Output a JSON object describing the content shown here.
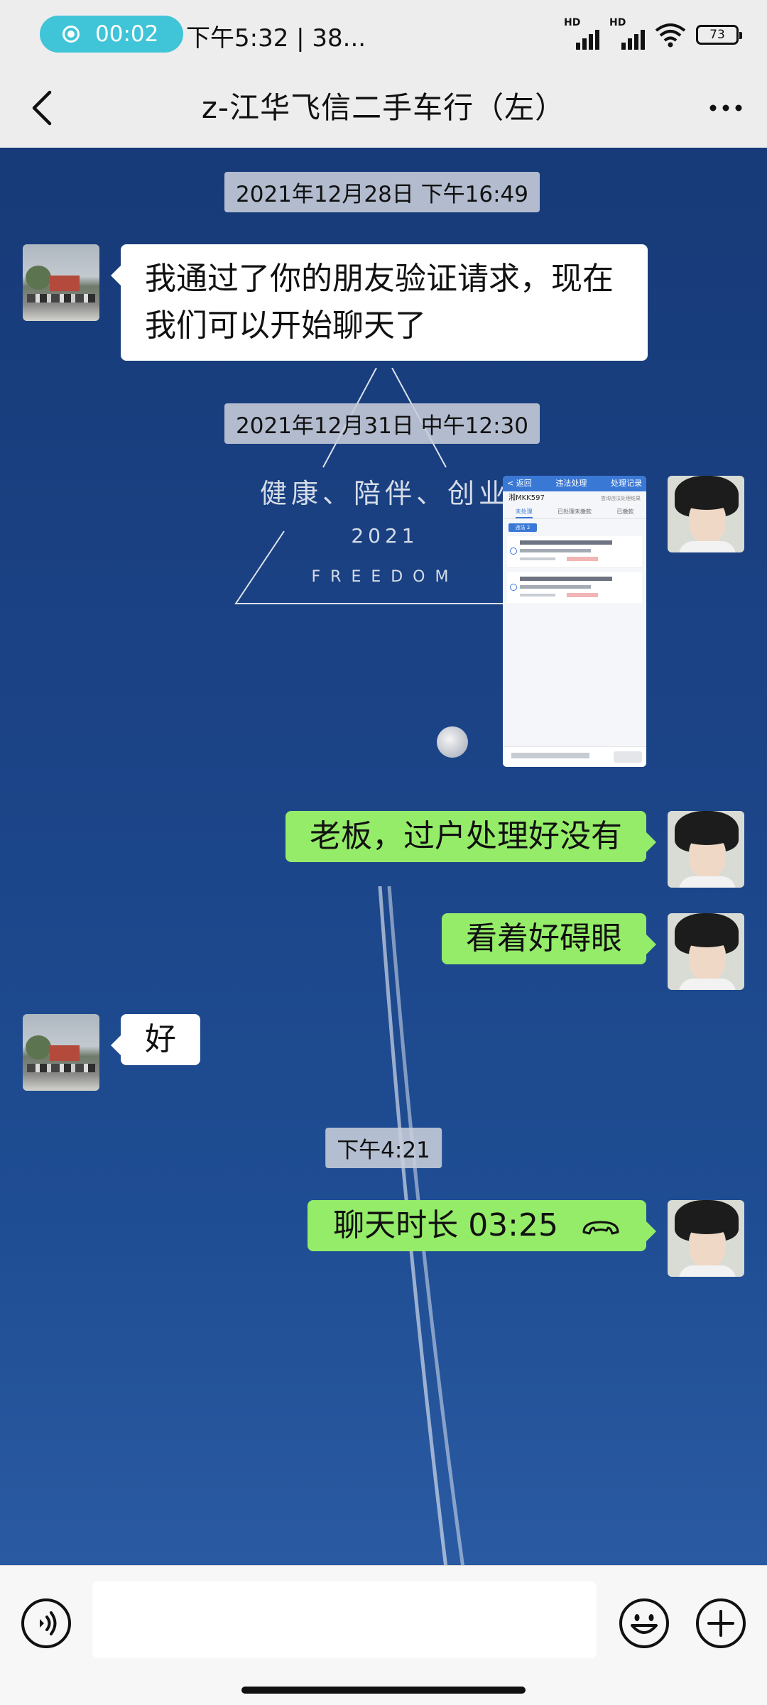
{
  "status_bar": {
    "recording_time": "00:02",
    "text": "下午5:32 | 38...",
    "signal_label_1": "HD",
    "signal_label_2": "HD",
    "battery": "73"
  },
  "header": {
    "title": "z-江华飞信二手车行（左）"
  },
  "wallpaper": {
    "line1": "健康、陪伴、创业",
    "line2": "2021",
    "line3": "FREEDOM"
  },
  "messages": {
    "ts1": "2021年12月28日 下午16:49",
    "msg1": "我通过了你的朋友验证请求，现在我们可以开始聊天了",
    "ts2": "2021年12月31日 中午12:30",
    "img": {
      "back": "< 返回",
      "title": "违法处理",
      "action": "处理记录",
      "plate": "湘MKK597",
      "plate_note": "查询违法处理结果",
      "tabs": [
        "未处理",
        "已处理未缴款",
        "已缴款"
      ],
      "chip": "违法 2"
    },
    "msg2": "老板，过户处理好没有",
    "msg3": "看着好碍眼",
    "msg4": "好",
    "ts3": "下午4:21",
    "msg5": "聊天时长 03:25"
  },
  "input_bar": {
    "placeholder": ""
  },
  "icons": {
    "back": "back-arrow-icon",
    "more": "more-dots-icon",
    "voice": "voice-icon",
    "emoji": "emoji-icon",
    "add": "plus-icon",
    "call": "phone-hangup-icon"
  },
  "colors": {
    "incoming_bubble": "#ffffff",
    "outgoing_bubble": "#95ec69",
    "recording_pill": "#40c4d8",
    "chat_background": "#1b4386"
  }
}
